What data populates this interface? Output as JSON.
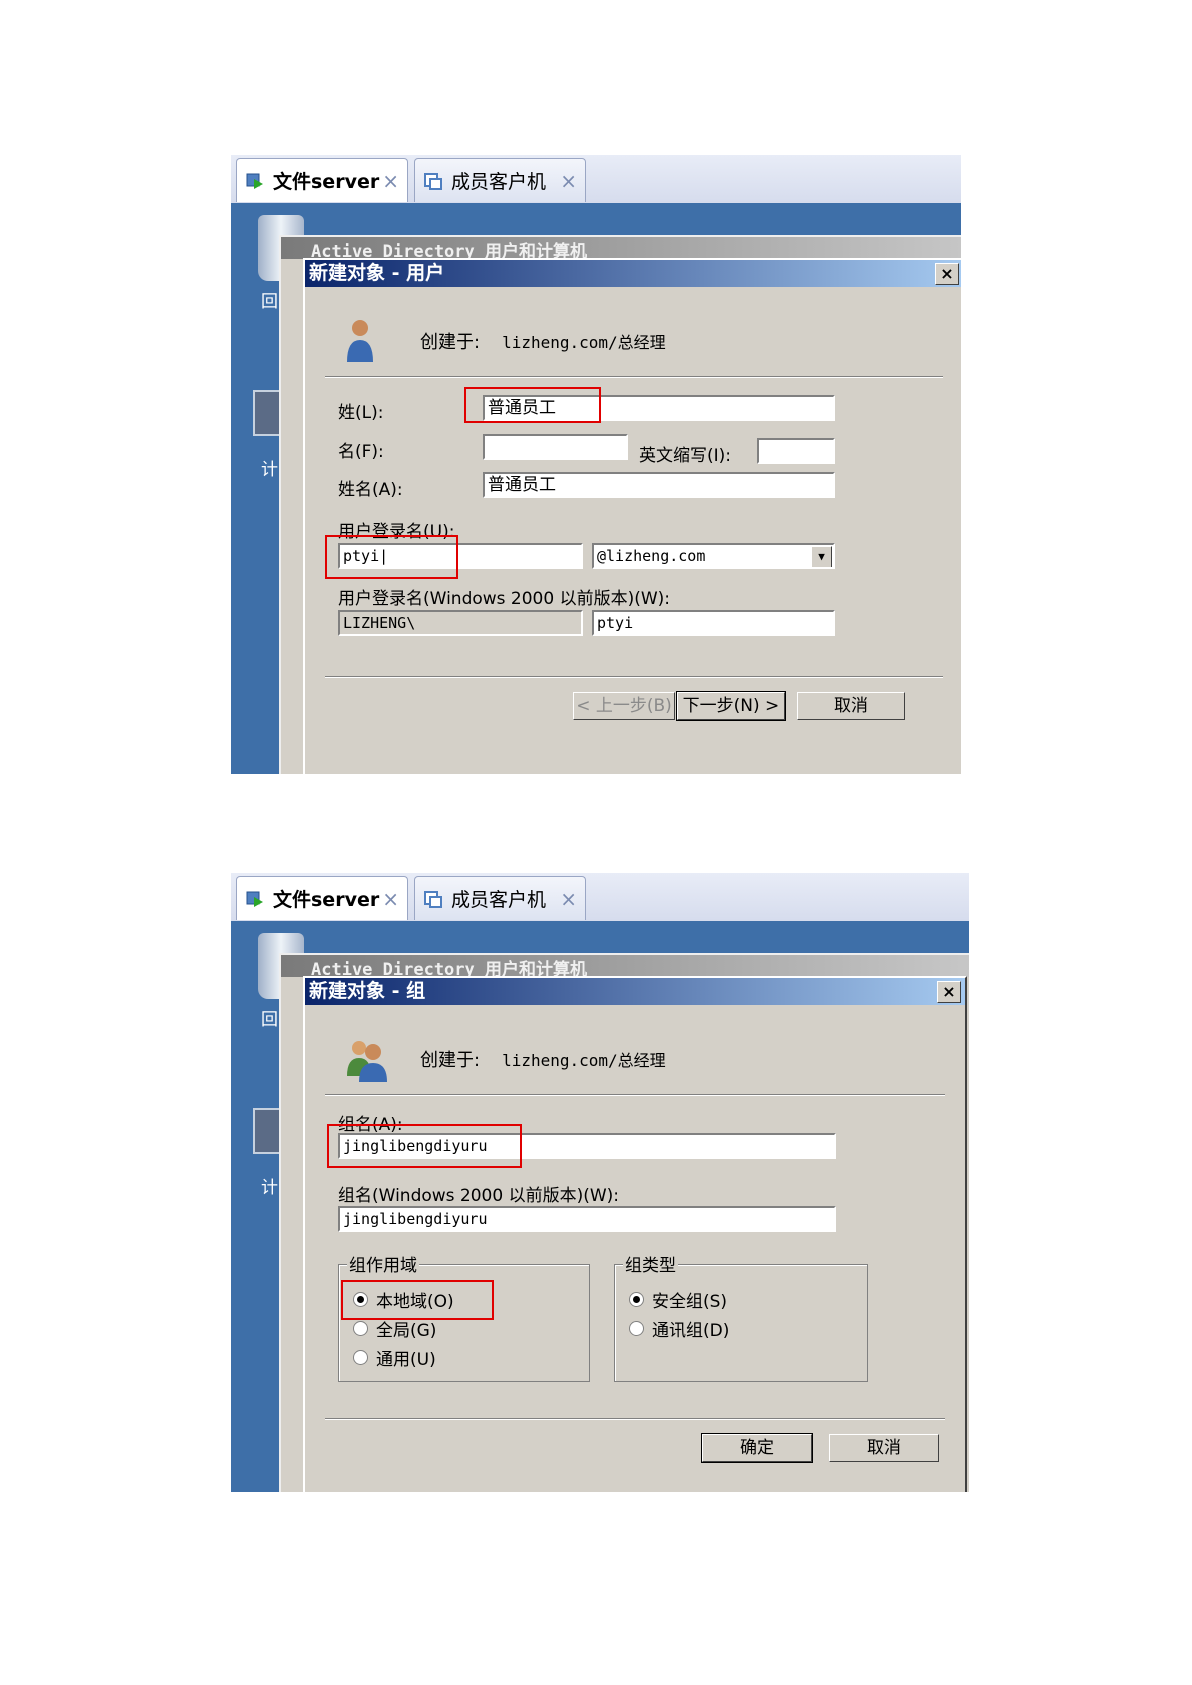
{
  "shot1": {
    "tabs": [
      {
        "label": "文件server",
        "close": "×"
      },
      {
        "label": "成员客户机",
        "close": "×"
      }
    ],
    "desktop_text": [
      "回",
      "计"
    ],
    "behind_title": "Active Directory 用户和计算机",
    "dialog": {
      "title": "新建对象 - 用户",
      "close": "×",
      "created_label": "创建于:",
      "created_path": "lizheng.com/总经理",
      "last_name_label": "姓(L):",
      "last_name_value": "普通员工",
      "first_name_label": "名(F):",
      "first_name_value": "",
      "initials_label": "英文缩写(I):",
      "initials_value": "",
      "full_name_label": "姓名(A):",
      "full_name_value": "普通员工",
      "logon_label": "用户登录名(U):",
      "logon_value": "ptyi|",
      "domain_value": "@lizheng.com",
      "pre2000_label": "用户登录名(Windows 2000 以前版本)(W):",
      "pre2000_domain": "LIZHENG\\",
      "pre2000_value": "ptyi",
      "back_button": "< 上一步(B)",
      "next_button": "下一步(N) >",
      "cancel_button": "取消"
    }
  },
  "shot2": {
    "tabs": [
      {
        "label": "文件server",
        "close": "×"
      },
      {
        "label": "成员客户机",
        "close": "×"
      }
    ],
    "desktop_text": [
      "回",
      "计"
    ],
    "behind_title": "Active Directory 用户和计算机",
    "dialog": {
      "title": "新建对象 - 组",
      "close": "×",
      "created_label": "创建于:",
      "created_path": "lizheng.com/总经理",
      "group_name_label": "组名(A):",
      "group_name_value": "jinglibengdiyuru",
      "pre2000_label": "组名(Windows 2000 以前版本)(W):",
      "pre2000_value": "jinglibengdiyuru",
      "scope_legend": "组作用域",
      "scope_options": [
        "本地域(O)",
        "全局(G)",
        "通用(U)"
      ],
      "type_legend": "组类型",
      "type_options": [
        "安全组(S)",
        "通讯组(D)"
      ],
      "ok_button": "确定",
      "cancel_button": "取消"
    }
  },
  "colors": {
    "desktop": "#3e6fa8",
    "dialog_bg": "#d4d0c8",
    "title_start": "#0a246a",
    "title_end": "#a6caf0",
    "highlight": "#e00000"
  }
}
